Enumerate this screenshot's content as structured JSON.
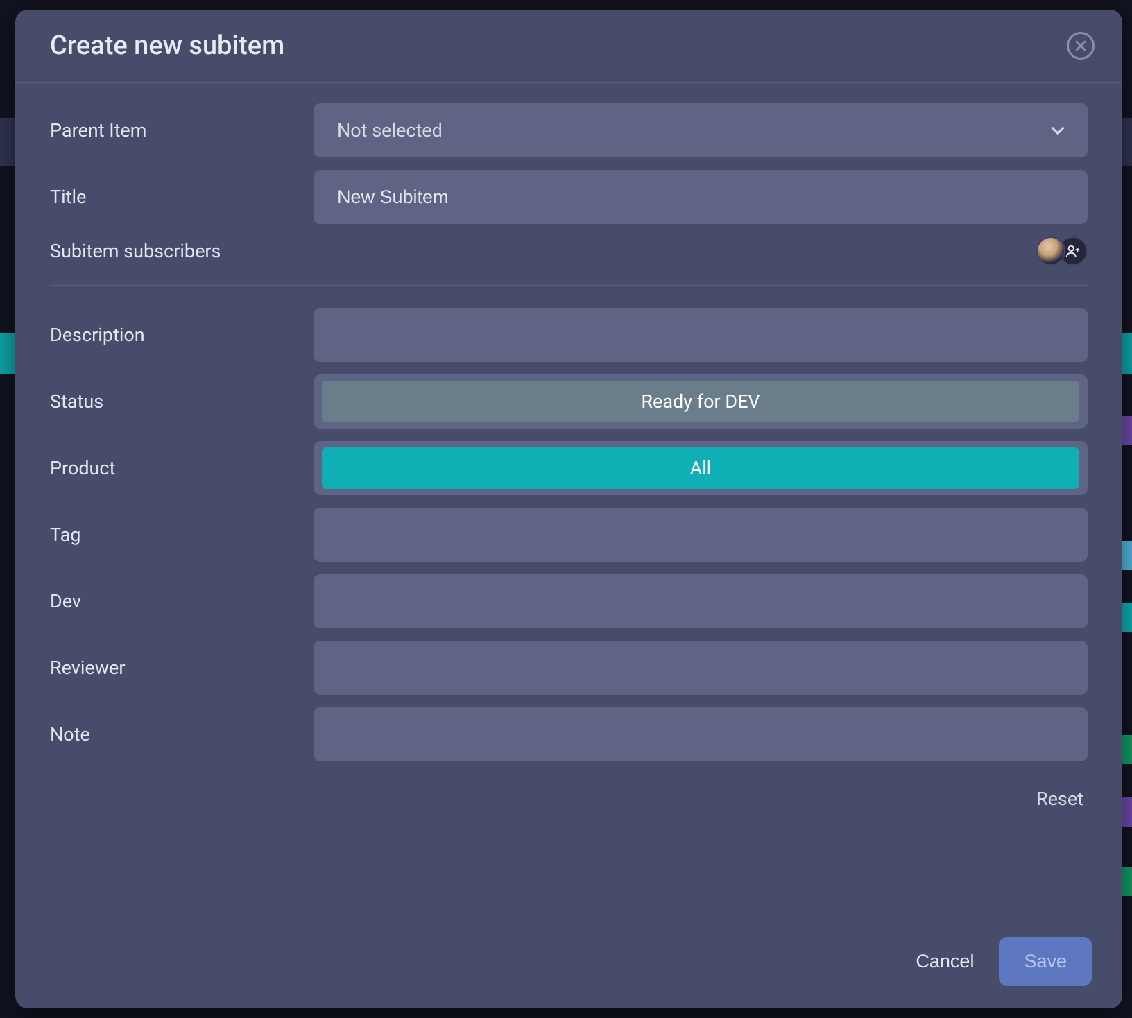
{
  "modal": {
    "title": "Create new subitem",
    "fields": {
      "parent_item": {
        "label": "Parent Item",
        "value": "Not selected"
      },
      "title": {
        "label": "Title",
        "value": "New Subitem"
      },
      "subscribers": {
        "label": "Subitem subscribers"
      },
      "description": {
        "label": "Description",
        "value": ""
      },
      "status": {
        "label": "Status",
        "value": "Ready for DEV",
        "color": "#6a7d8b"
      },
      "product": {
        "label": "Product",
        "value": "All",
        "color": "#10aeb5"
      },
      "tag": {
        "label": "Tag",
        "value": ""
      },
      "dev": {
        "label": "Dev",
        "value": ""
      },
      "reviewer": {
        "label": "Reviewer",
        "value": ""
      },
      "note": {
        "label": "Note",
        "value": ""
      }
    },
    "reset_label": "Reset",
    "footer": {
      "cancel": "Cancel",
      "save": "Save"
    }
  },
  "icons": {
    "close": "close-icon",
    "chevron_down": "chevron-down-icon",
    "add_person": "add-person-icon",
    "avatar": "user-avatar"
  }
}
